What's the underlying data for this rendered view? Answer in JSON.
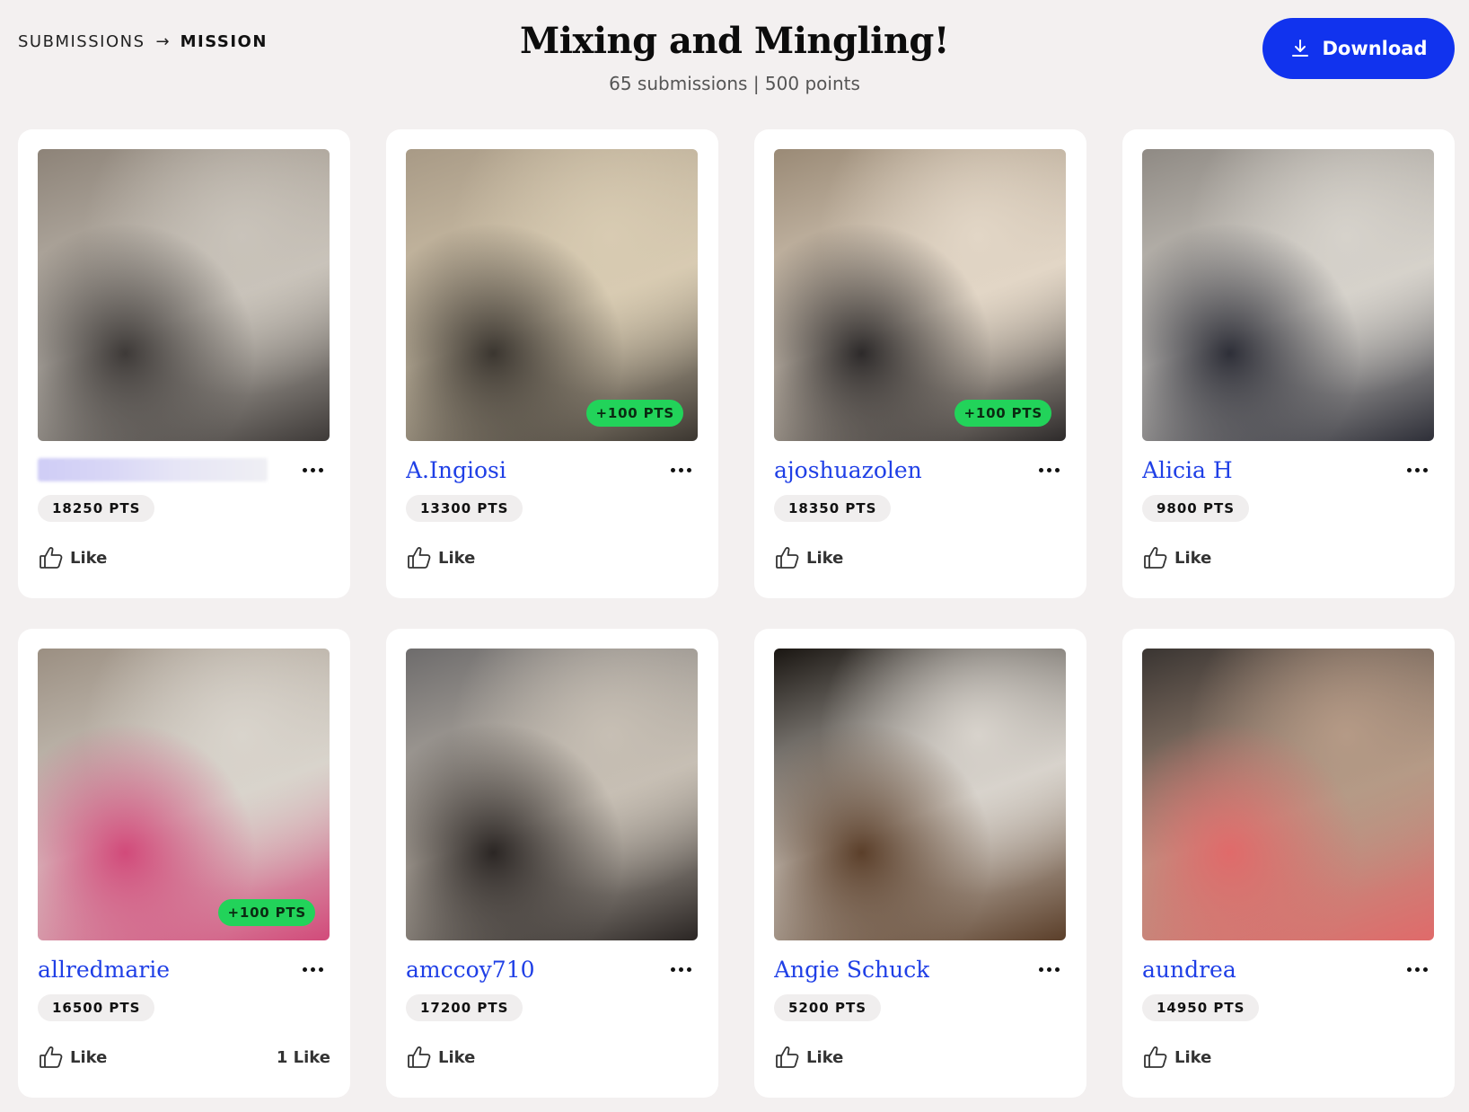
{
  "breadcrumb": {
    "parent": "SUBMISSIONS",
    "current": "MISSION"
  },
  "header": {
    "title": "Mixing and Mingling!",
    "subtitle": "65 submissions | 500 points",
    "download_label": "Download"
  },
  "like_label": "Like",
  "submissions": [
    {
      "name": "",
      "blurred": true,
      "points": "18250 PTS",
      "bonus": "",
      "likes": "",
      "photo_colors": [
        "#8d8378",
        "#c9c3ba",
        "#3e3a38"
      ]
    },
    {
      "name": "A.Ingiosi",
      "blurred": false,
      "points": "13300 PTS",
      "bonus": "+100 PTS",
      "likes": "",
      "photo_colors": [
        "#a89a86",
        "#d8cbb2",
        "#3b3630"
      ]
    },
    {
      "name": "ajoshuazolen",
      "blurred": false,
      "points": "18350 PTS",
      "bonus": "+100 PTS",
      "likes": "",
      "photo_colors": [
        "#9a8a76",
        "#e2d6c6",
        "#2d2a2a"
      ]
    },
    {
      "name": "Alicia H",
      "blurred": false,
      "points": "9800 PTS",
      "bonus": "",
      "likes": "",
      "photo_colors": [
        "#8f8a84",
        "#d6d2cb",
        "#2e2f38"
      ]
    },
    {
      "name": "allredmarie",
      "blurred": false,
      "points": "16500 PTS",
      "bonus": "+100 PTS",
      "likes": "1 Like",
      "photo_colors": [
        "#9b8f82",
        "#d9d4cc",
        "#d24a7a"
      ]
    },
    {
      "name": "amccoy710",
      "blurred": false,
      "points": "17200 PTS",
      "bonus": "",
      "likes": "",
      "photo_colors": [
        "#6e6c6c",
        "#c7bfb4",
        "#2b2624"
      ]
    },
    {
      "name": "Angie Schuck",
      "blurred": false,
      "points": "5200 PTS",
      "bonus": "",
      "likes": "",
      "photo_colors": [
        "#1a1612",
        "#d8d3cc",
        "#5b3f2a"
      ]
    },
    {
      "name": "aundrea",
      "blurred": false,
      "points": "14950 PTS",
      "bonus": "",
      "likes": "",
      "photo_colors": [
        "#3a3532",
        "#b59a86",
        "#e06a6a"
      ]
    }
  ],
  "colors": {
    "accent": "#1133ee",
    "username": "#1f3fe6",
    "bonus_badge": "#22d35a",
    "background": "#f3f0f0"
  }
}
